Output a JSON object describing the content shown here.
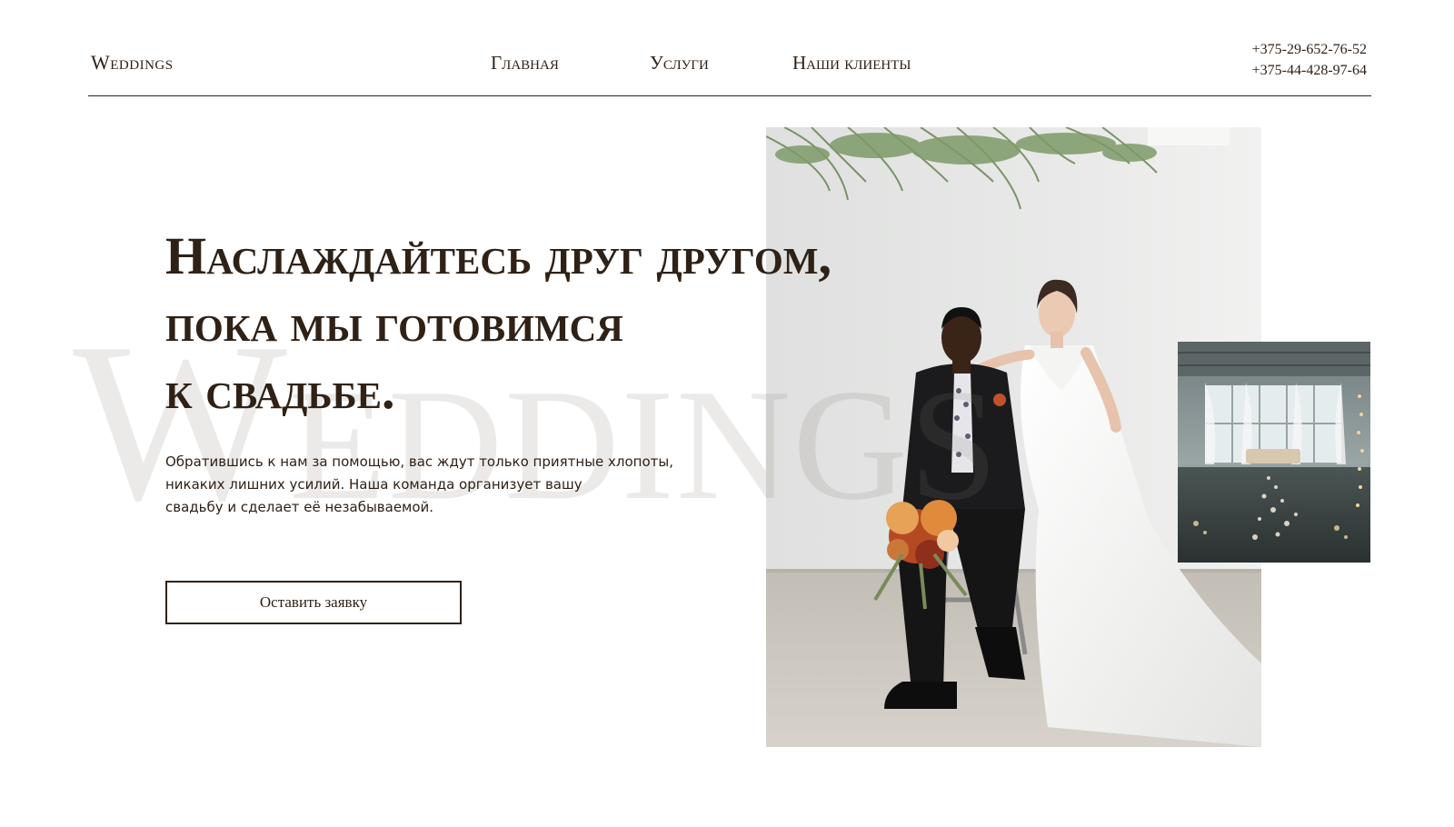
{
  "header": {
    "logo": "Weddings",
    "nav": [
      {
        "label": "Главная"
      },
      {
        "label": "Услуги"
      },
      {
        "label": "Наши клиенты"
      }
    ],
    "phones": [
      "+375-29-652-76-52",
      "+375-44-428-97-64"
    ]
  },
  "hero": {
    "title_lines": [
      "Наслаждайтесь друг другом,",
      "пока мы готовимся",
      "к свадьбе."
    ],
    "description_lines": [
      "Обратившись к нам за помощью, вас ждут только приятные хлопоты,",
      "никаких лишних усилий. Наша команда организует вашу",
      "свадьбу и сделает её незабываемой."
    ],
    "cta_label": "Оставить заявку",
    "watermark": "Weddings"
  },
  "colors": {
    "text": "#2f2116",
    "background": "#ffffff",
    "watermark": "rgba(130,125,120,0.16)"
  }
}
